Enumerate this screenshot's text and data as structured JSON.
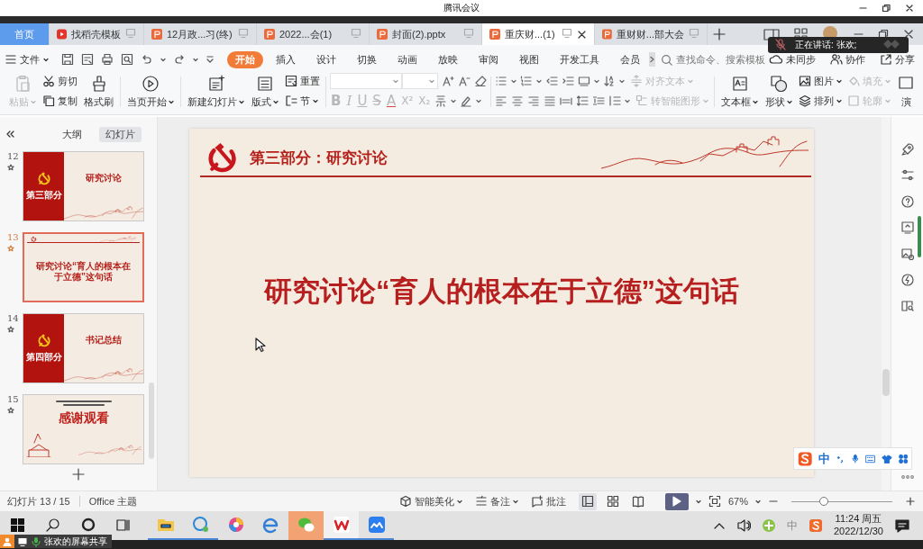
{
  "meeting_window": {
    "title": "腾讯会议"
  },
  "speaker_popup": {
    "text": "正在讲话: 张欢;"
  },
  "tabs": [
    {
      "kind": "home",
      "label": "首页",
      "selected": false
    },
    {
      "kind": "docer",
      "label": "找稻壳模板",
      "selected": false
    },
    {
      "kind": "pptx",
      "label": "12月政...习(终)",
      "selected": false
    },
    {
      "kind": "pptx",
      "label": "2022...会(1)",
      "selected": false
    },
    {
      "kind": "pptx",
      "label": "封面(2).pptx",
      "selected": false
    },
    {
      "kind": "pptx",
      "label": "重庆财...(1)",
      "selected": true
    },
    {
      "kind": "pptx",
      "label": "重财财...部大会",
      "selected": false
    }
  ],
  "menu": {
    "file": "文件",
    "ribbon_tabs": [
      {
        "label": "开始",
        "selected": true
      },
      {
        "label": "插入",
        "selected": false
      },
      {
        "label": "设计",
        "selected": false
      },
      {
        "label": "切换",
        "selected": false
      },
      {
        "label": "动画",
        "selected": false
      },
      {
        "label": "放映",
        "selected": false
      },
      {
        "label": "审阅",
        "selected": false
      },
      {
        "label": "视图",
        "selected": false
      },
      {
        "label": "开发工具",
        "selected": false
      },
      {
        "label": "会员",
        "selected": false
      }
    ],
    "search_placeholder": "查找命令、搜索模板",
    "actions": [
      "未同步",
      "协作",
      "分享"
    ]
  },
  "ribbon": {
    "paste": {
      "label": "粘贴",
      "disabled": true
    },
    "cut": {
      "label": "剪切",
      "disabled": false
    },
    "copy": {
      "label": "复制",
      "disabled": false
    },
    "format_painter": {
      "label": "格式刷",
      "disabled": false
    },
    "play_from_current": {
      "label": "当页开始",
      "disabled": false
    },
    "new_slide": {
      "label": "新建幻灯片",
      "disabled": false
    },
    "layout": {
      "label": "版式",
      "disabled": false
    },
    "reset": {
      "label": "重置",
      "disabled": false
    },
    "section": {
      "label": "节",
      "disabled": false
    },
    "font_styles": [
      {
        "kind": "bold",
        "label": "B",
        "disabled": true
      },
      {
        "kind": "italic",
        "label": "I",
        "disabled": true
      },
      {
        "kind": "underline",
        "label": "U",
        "disabled": true
      },
      {
        "kind": "strike",
        "label": "S",
        "disabled": true
      },
      {
        "kind": "color",
        "label": "A",
        "disabled": true
      },
      {
        "kind": "superscript",
        "label": "X²",
        "disabled": true
      },
      {
        "kind": "subscript",
        "label": "X₂",
        "disabled": true
      }
    ],
    "align_text": {
      "label": "对齐文本",
      "disabled": true
    },
    "smart_art": {
      "label": "转智能图形",
      "disabled": true
    },
    "text_box": {
      "label": "文本框",
      "disabled": false
    },
    "shape": {
      "label": "形状",
      "disabled": false
    },
    "picture": {
      "label": "图片",
      "disabled": false
    },
    "arrange": {
      "label": "排列",
      "disabled": false
    },
    "fill": {
      "label": "填充",
      "disabled": true
    },
    "outline": {
      "label": "轮廓",
      "disabled": true
    },
    "presentation_tools": {
      "label": "演",
      "disabled": false
    }
  },
  "slide_panel": {
    "tabs": [
      {
        "label": "大纲",
        "selected": false
      },
      {
        "label": "幻灯片",
        "selected": true
      }
    ],
    "slides": [
      {
        "number": "12",
        "kind": "section",
        "part": "第三部分",
        "title": "研究讨论",
        "selected": false
      },
      {
        "number": "13",
        "kind": "content",
        "text": "研究讨论“育人的根本在于立德”这句话",
        "selected": true
      },
      {
        "number": "14",
        "kind": "section",
        "part": "第四部分",
        "title": "书记总结",
        "selected": false
      },
      {
        "number": "15",
        "kind": "ending",
        "title": "感谢观看",
        "selected": false
      }
    ]
  },
  "slide": {
    "section_title": "第三部分：研究讨论",
    "title": "研究讨论“育人的根本在于立德”这句话"
  },
  "status_bar": {
    "slide_counter": "幻灯片 13 / 15",
    "theme": "Office 主题",
    "beautify": "智能美化",
    "notes": "备注",
    "comments": "批注",
    "views": [
      {
        "selected": true
      },
      {
        "selected": false
      },
      {
        "selected": false
      }
    ],
    "zoom": "67%",
    "zoom_slider": {
      "level": 0.3
    }
  },
  "ime_toolbar": {
    "mode": "中"
  },
  "taskbar": {
    "apps": [
      {
        "running": true,
        "flashing": false,
        "focused": false
      },
      {
        "running": true,
        "flashing": false,
        "focused": false
      },
      {
        "running": false,
        "flashing": false,
        "focused": false
      },
      {
        "running": false,
        "flashing": false,
        "focused": false
      },
      {
        "running": false,
        "flashing": true,
        "focused": false
      },
      {
        "running": true,
        "flashing": false,
        "focused": true
      },
      {
        "running": true,
        "flashing": false,
        "focused": false
      }
    ],
    "input_indicator": "中",
    "time": "11:24 周五",
    "date": "2022/12/30"
  },
  "screen_share": {
    "label": "张欢的屏幕共享"
  }
}
